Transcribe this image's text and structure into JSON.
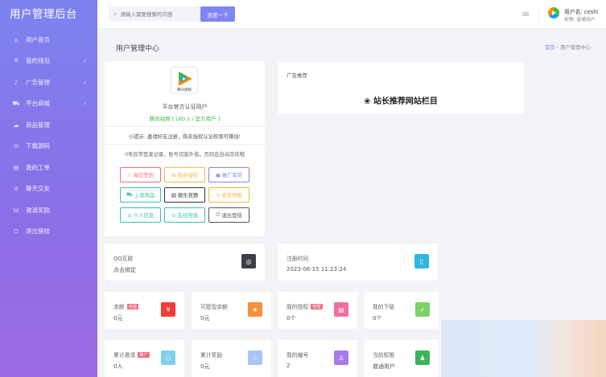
{
  "brand": "用户管理后台",
  "nav": [
    {
      "label": "用户首页",
      "icon": "⌂",
      "icon_name": "home-icon",
      "chev": false
    },
    {
      "label": "我的钱包",
      "icon": "¥",
      "icon_name": "wallet-icon",
      "chev": true
    },
    {
      "label": "广告管理",
      "icon": "♪",
      "icon_name": "bell-icon",
      "chev": true
    },
    {
      "label": "平台商城",
      "icon": "⛟",
      "icon_name": "cart-icon",
      "chev": true
    },
    {
      "label": "商品管理",
      "icon": "☁",
      "icon_name": "cloud-icon",
      "chev": false
    },
    {
      "label": "下载源码",
      "icon": "⊙",
      "icon_name": "download-icon",
      "chev": false
    },
    {
      "label": "我的工单",
      "icon": "▤",
      "icon_name": "ticket-icon",
      "chev": false
    },
    {
      "label": "聊天交友",
      "icon": "☌",
      "icon_name": "chat-icon",
      "chev": false
    },
    {
      "label": "邀请奖励",
      "icon": "⛁",
      "icon_name": "invite-icon",
      "chev": false
    },
    {
      "label": "退出登陆",
      "icon": "⏻",
      "icon_name": "logout-icon",
      "chev": false
    }
  ],
  "search": {
    "placeholder": "请输入需要搜索的内容",
    "button": "百度一下"
  },
  "user": {
    "name": "用户名: ceshi",
    "role": "权限: 普通用户"
  },
  "page": {
    "title": "用户管理中心",
    "crumb_home": "首页",
    "crumb_sep": "›",
    "crumb_current": "用户管理中心"
  },
  "profile": {
    "logo_text": "腾讯视频",
    "name": "平台官方认证用户",
    "uid": "腾讯视频 [ UID:2 / 官方用户 ]",
    "tip": "小提示: 邀请好友注册，购买授权认证权限可赚钱!",
    "warning": "0条异常登录记录，账号切莫外借，否则会自动冻结哦",
    "buttons": [
      {
        "label": "每日签到",
        "icon": "☆",
        "color": "#f46a7a",
        "name": "checkin-button"
      },
      {
        "label": "购买授权",
        "icon": "⊗",
        "color": "#f5b940",
        "name": "buy-auth-button"
      },
      {
        "label": "推广有奖",
        "icon": "▣",
        "color": "#7f86f2",
        "name": "promo-button"
      },
      {
        "label": "上架商品",
        "icon": "⛟",
        "color": "#34c3a4",
        "name": "list-product-button"
      },
      {
        "label": "娱乐竞猜",
        "icon": "▤",
        "color": "#333333",
        "name": "quiz-button"
      },
      {
        "label": "收支明细",
        "icon": "⊙",
        "color": "#f5b940",
        "name": "finance-button"
      },
      {
        "label": "个人信息",
        "icon": "♙",
        "color": "#34c3a4",
        "name": "profile-info-button"
      },
      {
        "label": "在线充值",
        "icon": "⊙",
        "color": "#34c3a4",
        "name": "recharge-button"
      },
      {
        "label": "退出登陆",
        "icon": "⏻",
        "color": "#555555",
        "name": "logout-button"
      }
    ]
  },
  "ad": {
    "title": "广告推荐",
    "text": "站长推荐网站栏目",
    "icon": "❀"
  },
  "stats": [
    {
      "label": "QQ互联",
      "value": "点击绑定",
      "badge": "",
      "icon": "◎",
      "color": "#3a3f4a",
      "name": "qq-bind-card"
    },
    {
      "label": "注册时间",
      "value": "2023-06-15 11:23:24",
      "badge": "",
      "icon": "▯",
      "color": "#2fb7e0",
      "name": "register-time-card"
    },
    {
      "label": "余额",
      "value": "0元",
      "badge": "充值",
      "icon": "¥",
      "color": "#f23c3c",
      "name": "balance-card"
    },
    {
      "label": "可提现余额",
      "value": "0元",
      "badge": "",
      "icon": "★",
      "color": "#f58f3b",
      "name": "withdrawable-card"
    },
    {
      "label": "我的授权",
      "value": "0个",
      "badge": "管理",
      "icon": "▤",
      "color": "#f06fa0",
      "name": "my-auth-card"
    },
    {
      "label": "我的下级",
      "value": "0个",
      "badge": "",
      "icon": "✓",
      "color": "#7ad36a",
      "name": "subordinates-card"
    },
    {
      "label": "累计邀请",
      "value": "0人",
      "badge": "推广",
      "icon": "⬡",
      "color": "#7fd0ef",
      "name": "invites-card"
    },
    {
      "label": "累计奖励",
      "value": "0元",
      "badge": "",
      "icon": "☆",
      "color": "#a9c4f5",
      "name": "rewards-card"
    },
    {
      "label": "我的编号",
      "value": "2",
      "badge": "",
      "icon": "♙",
      "color": "#a87be8",
      "name": "my-id-card"
    },
    {
      "label": "当前权限",
      "value": "普通用户",
      "badge": "",
      "icon": "♟",
      "color": "#3eb35c",
      "name": "permission-card"
    }
  ]
}
